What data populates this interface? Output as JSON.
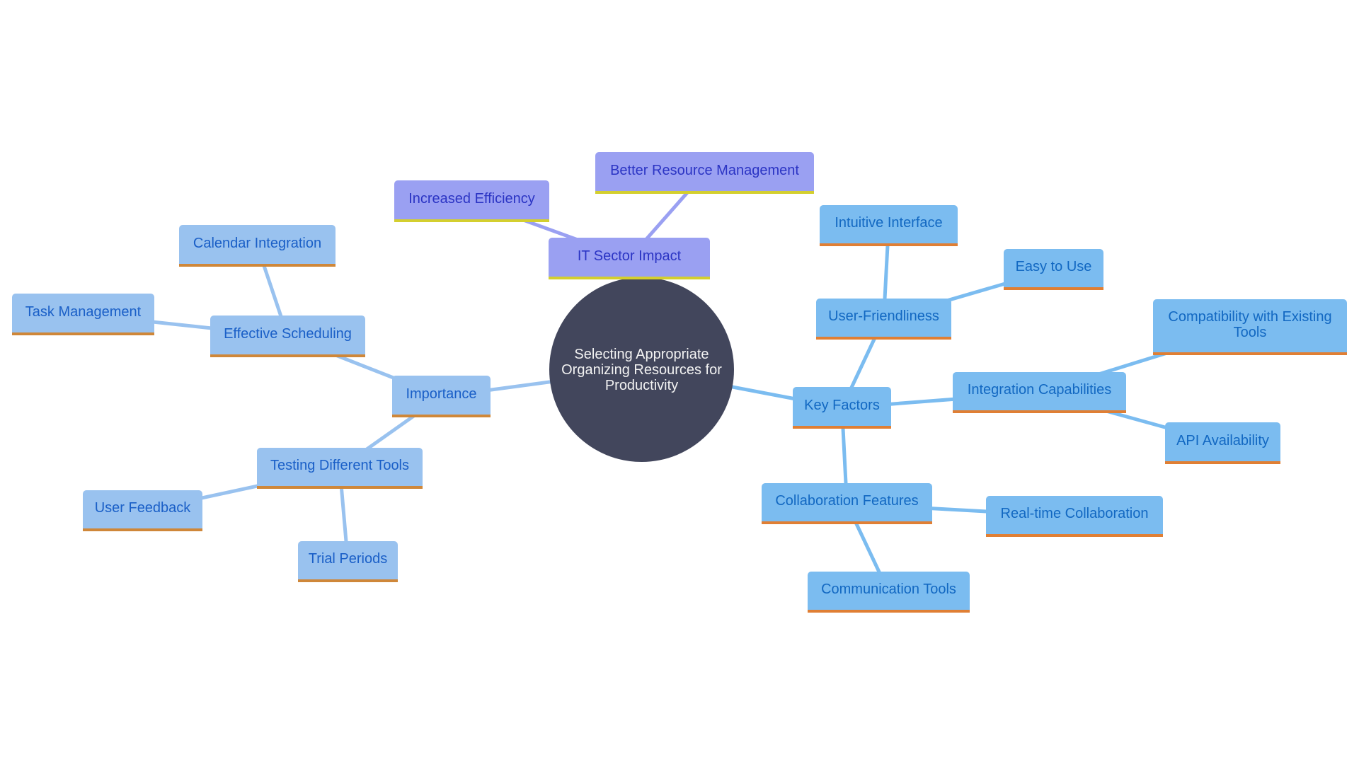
{
  "diagram": {
    "type": "mindmap",
    "root": {
      "id": "root",
      "label": "Selecting Appropriate Organizing Resources for Productivity"
    },
    "colors": {
      "root_fill": "#42465c",
      "left_branch_fill": "#99c2ef",
      "left_branch_accent": "#cf8739",
      "right_branch_fill": "#7bbcf0",
      "right_branch_accent": "#e07f34",
      "top_branch_fill": "#9aa0f2",
      "top_branch_accent": "#d4cf2f"
    },
    "nodes": [
      {
        "id": "importance",
        "label": "Importance",
        "parent": "root"
      },
      {
        "id": "effective_scheduling",
        "label": "Effective Scheduling",
        "parent": "importance"
      },
      {
        "id": "calendar_integration",
        "label": "Calendar Integration",
        "parent": "effective_scheduling"
      },
      {
        "id": "task_management",
        "label": "Task Management",
        "parent": "effective_scheduling"
      },
      {
        "id": "testing_tools",
        "label": "Testing Different Tools",
        "parent": "importance"
      },
      {
        "id": "user_feedback",
        "label": "User Feedback",
        "parent": "testing_tools"
      },
      {
        "id": "trial_periods",
        "label": "Trial Periods",
        "parent": "testing_tools"
      },
      {
        "id": "it_sector_impact",
        "label": "IT Sector Impact",
        "parent": "root"
      },
      {
        "id": "increased_efficiency",
        "label": "Increased Efficiency",
        "parent": "it_sector_impact"
      },
      {
        "id": "better_resource_mgmt",
        "label": "Better Resource Management",
        "parent": "it_sector_impact"
      },
      {
        "id": "key_factors",
        "label": "Key Factors",
        "parent": "root"
      },
      {
        "id": "user_friendliness",
        "label": "User-Friendliness",
        "parent": "key_factors"
      },
      {
        "id": "intuitive_interface",
        "label": "Intuitive Interface",
        "parent": "user_friendliness"
      },
      {
        "id": "easy_to_use",
        "label": "Easy to Use",
        "parent": "user_friendliness"
      },
      {
        "id": "integration_capabilities",
        "label": "Integration Capabilities",
        "parent": "key_factors"
      },
      {
        "id": "compatibility",
        "label": "Compatibility with Existing Tools",
        "parent": "integration_capabilities"
      },
      {
        "id": "api_availability",
        "label": "API Availability",
        "parent": "integration_capabilities"
      },
      {
        "id": "collaboration_features",
        "label": "Collaboration Features",
        "parent": "key_factors"
      },
      {
        "id": "realtime_collaboration",
        "label": "Real-time Collaboration",
        "parent": "collaboration_features"
      },
      {
        "id": "communication_tools",
        "label": "Communication Tools",
        "parent": "collaboration_features"
      }
    ]
  }
}
